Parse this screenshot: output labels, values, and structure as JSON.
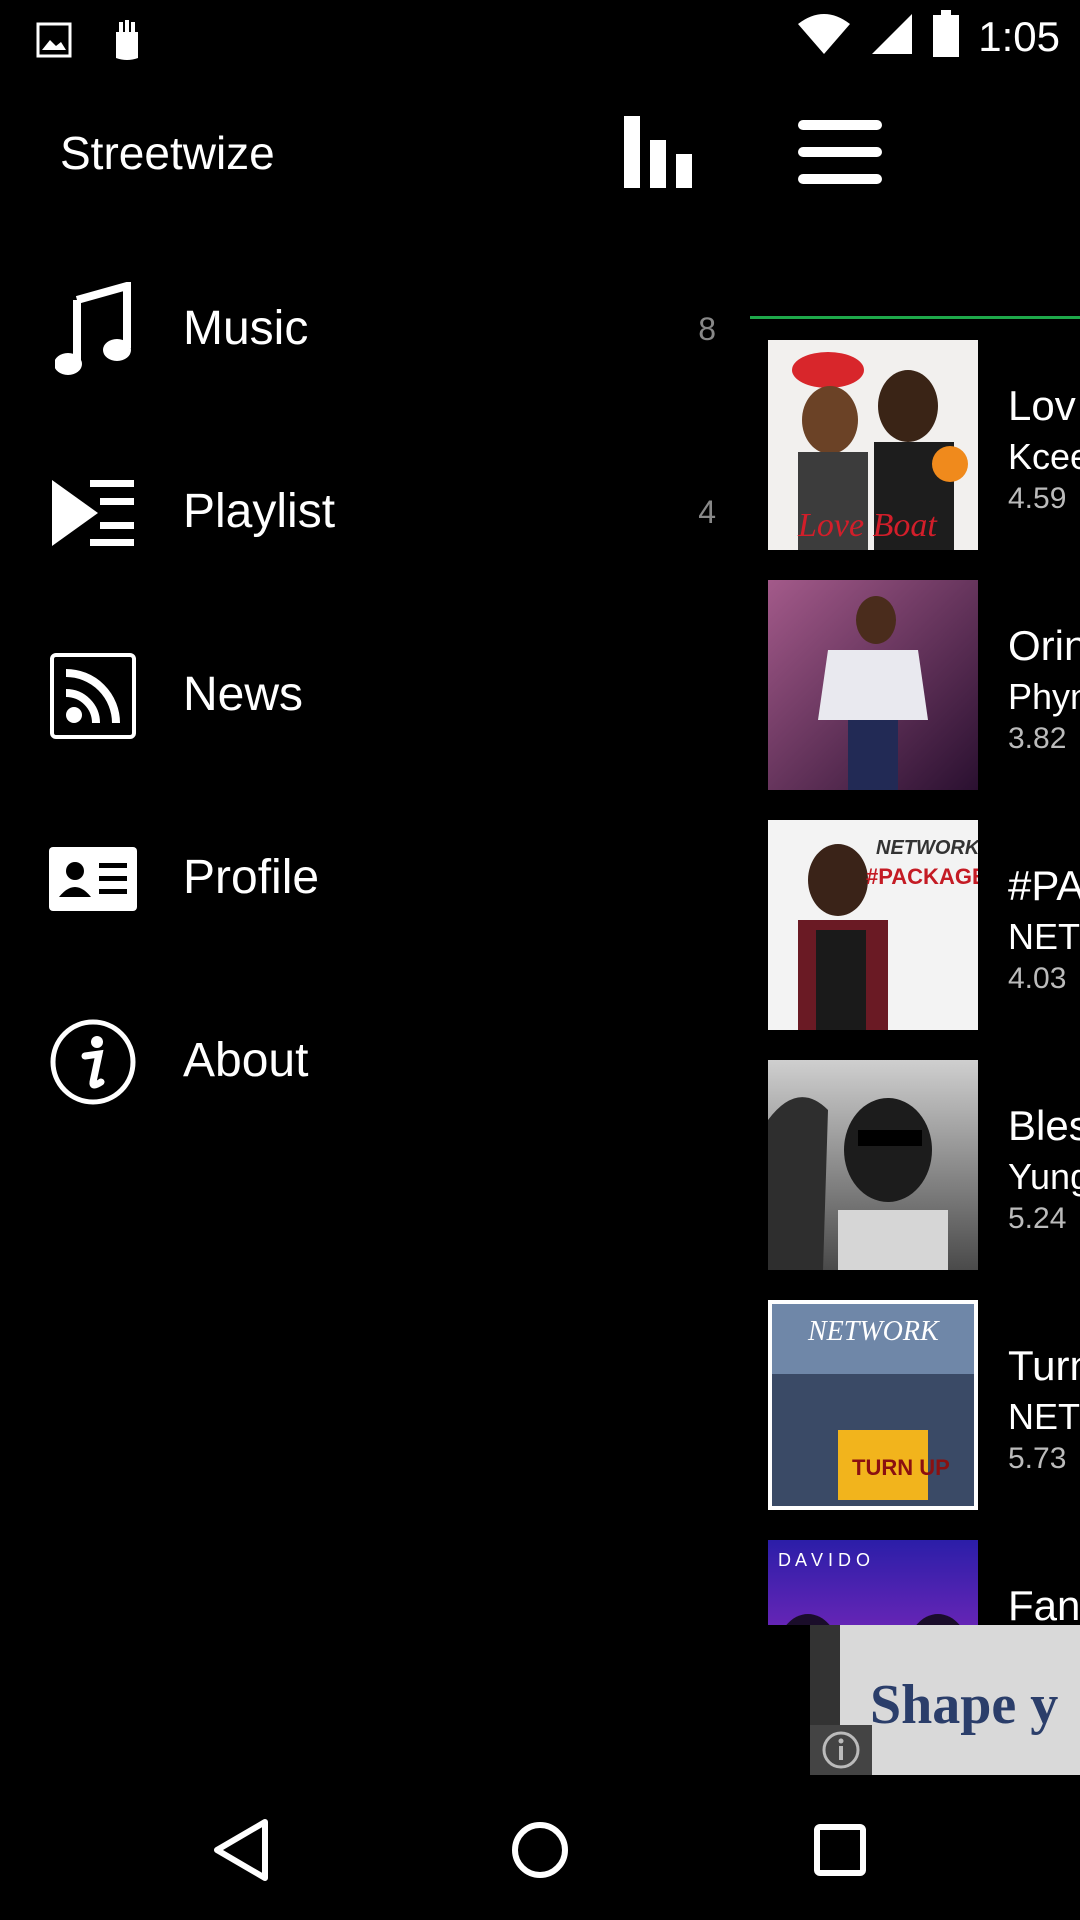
{
  "status_bar": {
    "time": "1:05",
    "icons": [
      "image-notification-icon",
      "app-notification-icon",
      "wifi-icon",
      "signal-icon",
      "battery-icon"
    ]
  },
  "app_title": "Streetwize",
  "header_icons": [
    "equalizer-icon",
    "hamburger-menu-icon"
  ],
  "nav": [
    {
      "label": "Music",
      "count": "8",
      "icon": "music-note-icon"
    },
    {
      "label": "Playlist",
      "count": "4",
      "icon": "playlist-icon"
    },
    {
      "label": "News",
      "count": "",
      "icon": "rss-icon"
    },
    {
      "label": "Profile",
      "count": "",
      "icon": "id-card-icon"
    },
    {
      "label": "About",
      "count": "",
      "icon": "info-icon"
    }
  ],
  "songs": [
    {
      "title": "Lov",
      "artist": "Kcee",
      "size": "4.59"
    },
    {
      "title": "Orin",
      "artist": "Phyn",
      "size": "3.82"
    },
    {
      "title": "#PA",
      "artist": "NET",
      "size": "4.03"
    },
    {
      "title": "Bles",
      "artist": "Yung",
      "size": "5.24"
    },
    {
      "title": "Turn",
      "artist": "NET",
      "size": "5.73"
    },
    {
      "title": "Fan",
      "artist": "",
      "size": ""
    }
  ],
  "album_art_text": {
    "love_boat": "Love Boat",
    "network": "NETWORK",
    "package": "#PACKAGE",
    "turn_up": "TURN UP",
    "davido": "D A V I D O"
  },
  "ad": {
    "text": "Shape y"
  },
  "colors": {
    "accent": "#1ea84a",
    "background": "#000000"
  }
}
